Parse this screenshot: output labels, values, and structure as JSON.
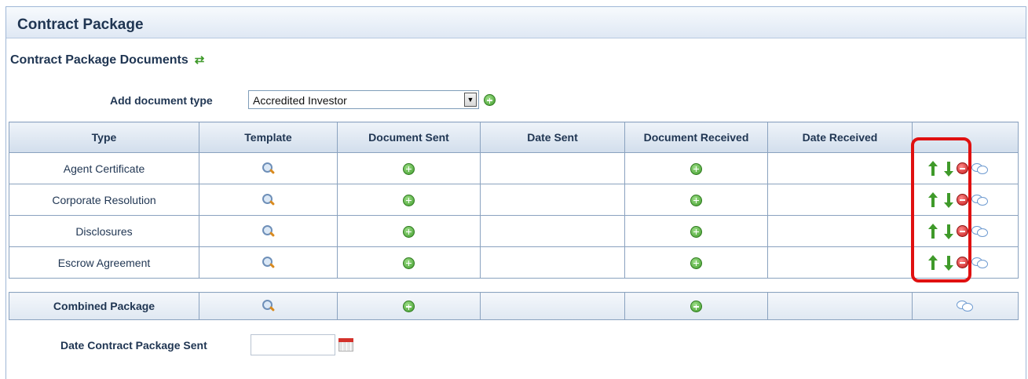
{
  "panel": {
    "title": "Contract Package"
  },
  "section": {
    "title": "Contract Package Documents",
    "refresh_icon": "refresh-icon"
  },
  "add_document": {
    "label": "Add document type",
    "selected": "Accredited Investor"
  },
  "table": {
    "headers": [
      "Type",
      "Template",
      "Document Sent",
      "Date Sent",
      "Document Received",
      "Date Received",
      ""
    ],
    "rows": [
      {
        "type": "Agent Certificate",
        "date_sent": "",
        "date_received": ""
      },
      {
        "type": "Corporate Resolution",
        "date_sent": "",
        "date_received": ""
      },
      {
        "type": "Disclosures",
        "date_sent": "",
        "date_received": ""
      },
      {
        "type": "Escrow Agreement",
        "date_sent": "",
        "date_received": ""
      }
    ]
  },
  "combined": {
    "label": "Combined Package",
    "date_sent": "",
    "date_received": ""
  },
  "date_contract": {
    "label": "Date Contract Package Sent",
    "value": ""
  },
  "colors": {
    "highlight": "#e01010",
    "header_text": "#1f3552",
    "accent_green": "#3f9a2a",
    "border": "#8aa2bf"
  }
}
